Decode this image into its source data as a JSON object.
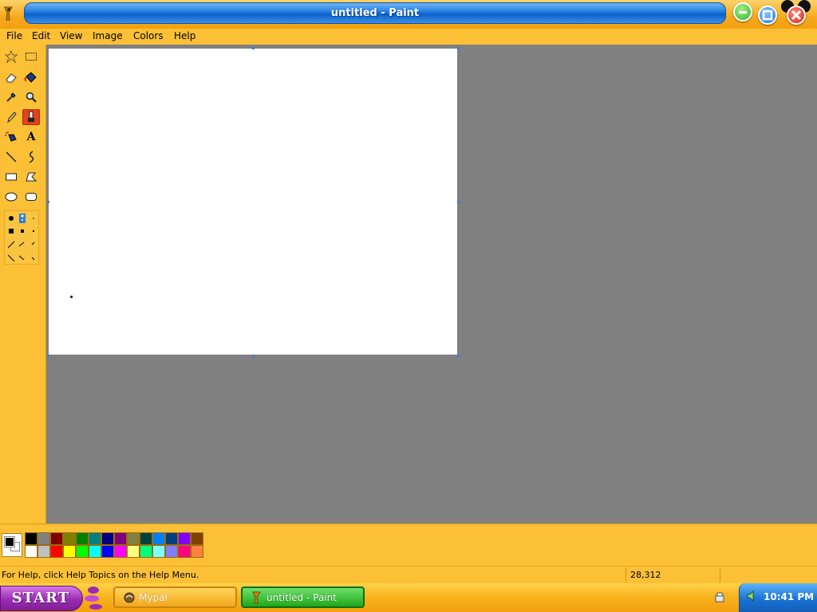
{
  "window": {
    "title": "untitled - Paint",
    "buttons": [
      "minimize",
      "maximize",
      "close"
    ]
  },
  "menu": {
    "items": [
      "File",
      "Edit",
      "View",
      "Image",
      "Colors",
      "Help"
    ]
  },
  "toolbox": {
    "tools": [
      {
        "icon": "free-form-select-icon"
      },
      {
        "icon": "rect-select-icon"
      },
      {
        "icon": "eraser-icon"
      },
      {
        "icon": "fill-bucket-icon"
      },
      {
        "icon": "color-picker-icon"
      },
      {
        "icon": "magnifier-icon"
      },
      {
        "icon": "pencil-icon"
      },
      {
        "icon": "brush-icon",
        "active": true
      },
      {
        "icon": "airbrush-icon"
      },
      {
        "icon": "text-icon",
        "label": "A"
      },
      {
        "icon": "line-icon"
      },
      {
        "icon": "curve-icon"
      },
      {
        "icon": "rectangle-icon"
      },
      {
        "icon": "polygon-icon"
      },
      {
        "icon": "ellipse-icon"
      },
      {
        "icon": "rounded-rectangle-icon"
      }
    ]
  },
  "palette": {
    "foreground": "#000000",
    "background": "#ffffff",
    "colors": [
      "#000000",
      "#808080",
      "#800000",
      "#808000",
      "#008000",
      "#008080",
      "#000080",
      "#800080",
      "#808040",
      "#004040",
      "#0080ff",
      "#004080",
      "#8000ff",
      "#804000",
      "#ffffff",
      "#c0c0c0",
      "#ff0000",
      "#ffff00",
      "#00ff00",
      "#00ffff",
      "#0000ff",
      "#ff00ff",
      "#ffff80",
      "#00ff80",
      "#80ffff",
      "#8080ff",
      "#ff0080",
      "#ff8040"
    ]
  },
  "status": {
    "help_text": "For Help, click Help Topics on the Help Menu.",
    "coords": "28,312"
  },
  "taskbar": {
    "start_label": "START",
    "tasks": [
      {
        "label": "Mypal",
        "icon": "mypal-icon"
      },
      {
        "label": "untitled - Paint",
        "icon": "paint-icon",
        "active": true
      }
    ],
    "clock": "10:41 PM"
  }
}
